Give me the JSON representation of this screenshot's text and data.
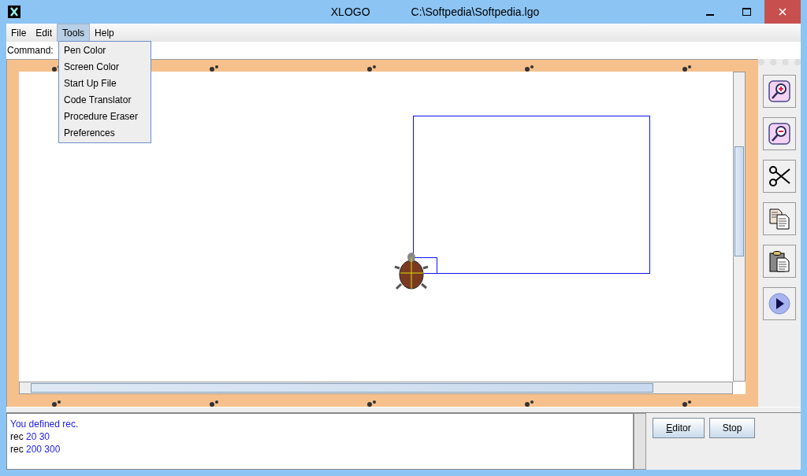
{
  "window": {
    "title": "XLOGO",
    "path": "C:\\Softpedia\\Softpedia.lgo"
  },
  "menu": [
    {
      "label": "File",
      "selected": false
    },
    {
      "label": "Edit",
      "selected": false
    },
    {
      "label": "Tools",
      "selected": true
    },
    {
      "label": "Help",
      "selected": false
    }
  ],
  "open_menu": {
    "items": [
      "Pen Color",
      "Screen Color",
      "Start Up File",
      "Code Translator",
      "Procedure Eraser",
      "Preferences"
    ]
  },
  "command": {
    "label": "Command:"
  },
  "toolbar": [
    {
      "kind": "zoom-in"
    },
    {
      "kind": "zoom-out"
    },
    {
      "kind": "cut"
    },
    {
      "kind": "copy"
    },
    {
      "kind": "paste"
    },
    {
      "kind": "run"
    }
  ],
  "history": [
    {
      "kind": "message",
      "text": "You defined rec."
    },
    {
      "kind": "command",
      "name": "rec",
      "args": "20 30"
    },
    {
      "kind": "command",
      "name": "rec",
      "args": "200 300"
    }
  ],
  "buttons": [
    {
      "label": "Editor",
      "mnemonic_underlined": true
    },
    {
      "label": "Stop"
    }
  ]
}
